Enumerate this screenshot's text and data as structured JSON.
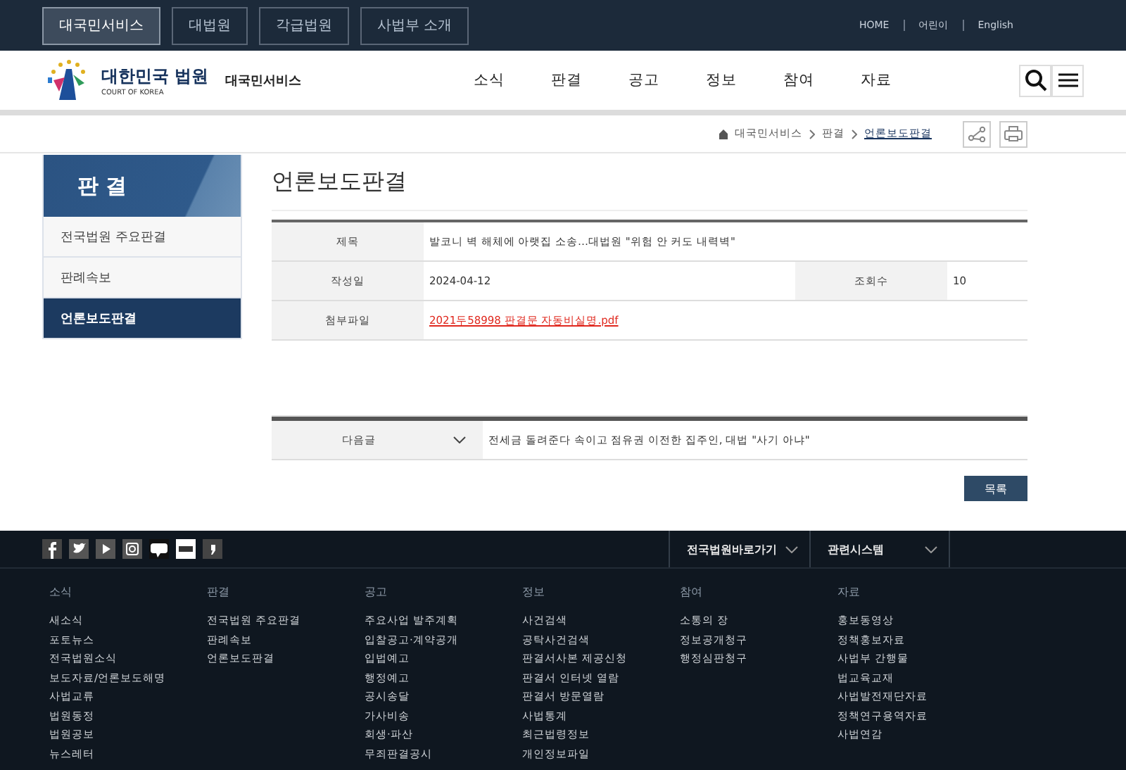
{
  "top_tabs": [
    {
      "label": "대국민서비스",
      "selected": true
    },
    {
      "label": "대법원",
      "selected": false
    },
    {
      "label": "각급법원",
      "selected": false
    },
    {
      "label": "사법부 소개",
      "selected": false
    }
  ],
  "top_links": [
    "HOME",
    "어린이",
    "English"
  ],
  "logo": {
    "name": "대한민국 법원",
    "sub": "COURT OF KOREA",
    "service": "대국민서비스"
  },
  "main_menu": [
    "소식",
    "판결",
    "공고",
    "정보",
    "참여",
    "자료"
  ],
  "breadcrumb": [
    "대국민서비스",
    "판결",
    "언론보도판결"
  ],
  "sidebar": {
    "title": "판 결",
    "items": [
      {
        "label": "전국법원 주요판결",
        "selected": false
      },
      {
        "label": "판례속보",
        "selected": false
      },
      {
        "label": "언론보도판결",
        "selected": true
      }
    ]
  },
  "page_title": "언론보도판결",
  "detail": {
    "title_label": "제목",
    "title": "발코니 벽 해체에 아랫집 소송…대법원 \"위험 안 커도 내력벽\"",
    "date_label": "작성일",
    "date": "2024-04-12",
    "views_label": "조회수",
    "views": "10",
    "file_label": "첨부파일",
    "file": "2021두58998 판결문 자동비실명.pdf"
  },
  "next": {
    "label": "다음글",
    "text": "전세금 돌려준다 속이고 점유권 이전한 집주인, 대법 \"사기 아냐\""
  },
  "list_button": "목록",
  "footer": {
    "dropdowns": [
      "전국법원바로가기",
      "관련시스템"
    ],
    "columns": [
      {
        "heading": "소식",
        "links": [
          "새소식",
          "포토뉴스",
          "전국법원소식",
          "보도자료/언론보도해명",
          "사법교류",
          "법원동정",
          "법원공보",
          "뉴스레터"
        ]
      },
      {
        "heading": "판결",
        "links": [
          "전국법원 주요판결",
          "판례속보",
          "언론보도판결"
        ]
      },
      {
        "heading": "공고",
        "links": [
          "주요사업 발주계획",
          "입찰공고·계약공개",
          "입법예고",
          "행정예고",
          "공시송달",
          "가사비송",
          "회생·파산",
          "무죄판결공시"
        ]
      },
      {
        "heading": "정보",
        "links": [
          "사건검색",
          "공탁사건검색",
          "판결서사본 제공신청",
          "판결서 인터넷 열람",
          "판결서 방문열람",
          "사법통계",
          "최근법령정보",
          "개인정보파일"
        ]
      },
      {
        "heading": "참여",
        "links": [
          "소통의 장",
          "정보공개청구",
          "행정심판청구"
        ]
      },
      {
        "heading": "자료",
        "links": [
          "홍보동영상",
          "정책홍보자료",
          "사법부 간행물",
          "법교육교재",
          "사법발전재단자료",
          "정책연구용역자료",
          "사법연감"
        ]
      }
    ]
  }
}
